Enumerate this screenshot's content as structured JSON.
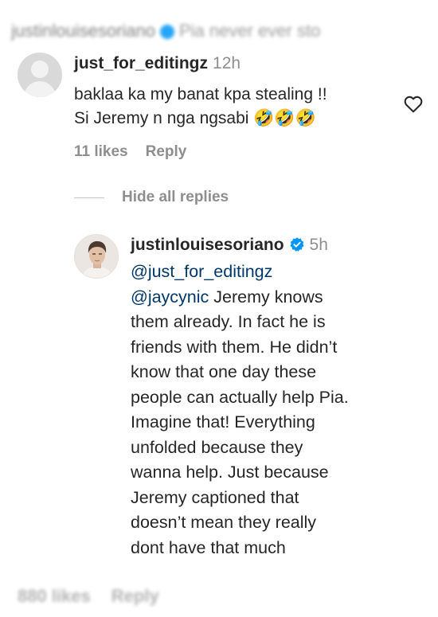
{
  "background_blur": {
    "top": {
      "username": "justinlouisesoriano",
      "text": "Pia never ever sto"
    },
    "bottom": {
      "likes": "880 likes",
      "reply": "Reply"
    }
  },
  "comment": {
    "username": "just_for_editingz",
    "time": "12h",
    "line1": "baklaa ka my banat kpa stealing !!",
    "line2": "Si Jeremy n nga ngsabi 🤣🤣🤣",
    "likes": "11 likes",
    "reply_label": "Reply",
    "icons": {
      "avatar": "default-avatar-icon",
      "like": "heart-outline-icon"
    }
  },
  "hide_replies": {
    "label": "Hide all replies"
  },
  "reply": {
    "username": "justinlouisesoriano",
    "time": "5h",
    "verified": true,
    "mention1": "@just_for_editingz",
    "mention2": "@jaycynic",
    "text_lines": [
      " Jeremy knows",
      "them already. In fact he is",
      "friends with them. He didn’t",
      "know that one day these",
      "people can actually help Pia.",
      "Imagine that! Everything",
      "unfolded because they",
      "wanna help. Just because",
      "Jeremy captioned that",
      "doesn’t mean they really",
      "dont have that much"
    ],
    "colors": {
      "mention": "#00376b",
      "verified": "#0095f6"
    }
  }
}
